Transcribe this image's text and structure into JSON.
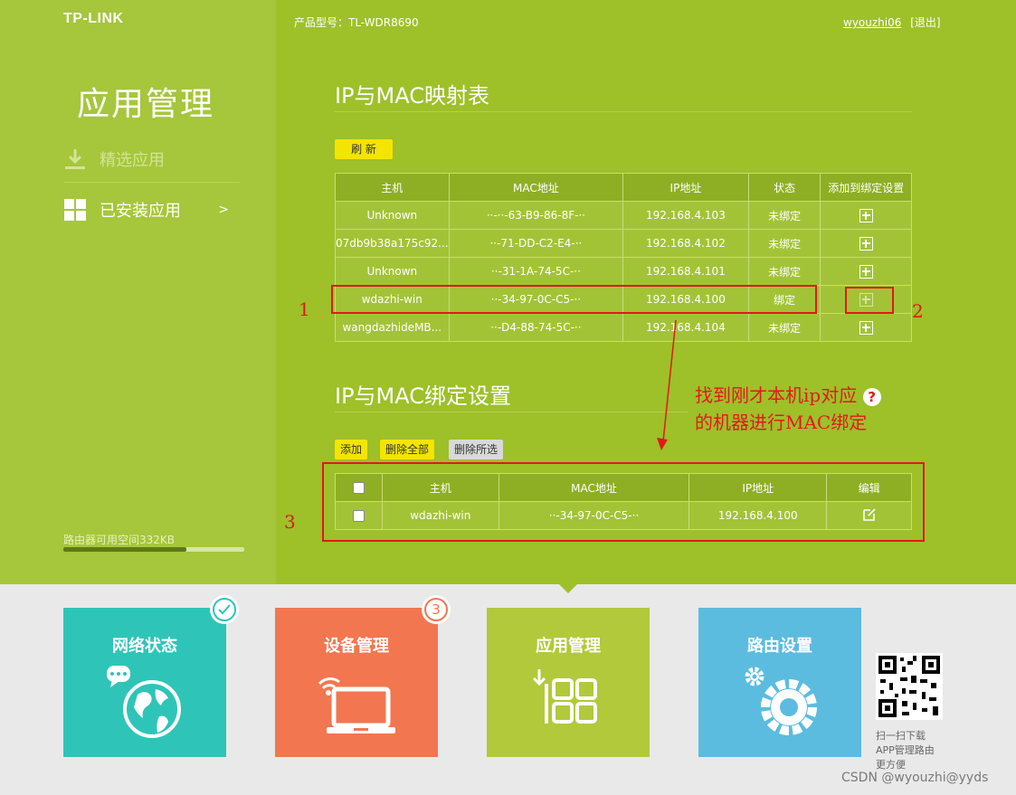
{
  "header": {
    "logo": "TP-LINK",
    "model": "产品型号：TL-WDR8690",
    "username": "wyouzhi06",
    "logout": "[退出]"
  },
  "sidebar": {
    "title": "应用管理",
    "items": [
      {
        "label": "精选应用",
        "icon": "download-icon"
      },
      {
        "label": "已安装应用",
        "icon": "grid-icon",
        "arrow": ">"
      }
    ],
    "storage_label": "路由器可用空间332KB",
    "storage_used_fraction": 0.68
  },
  "mapping": {
    "title": "IP与MAC映射表",
    "refresh_label": "刷 新",
    "columns": [
      "主机",
      "MAC地址",
      "IP地址",
      "状态",
      "添加到绑定设置"
    ],
    "rows": [
      {
        "host": "Unknown",
        "mac": "··-··-63-B9-86-8F-··",
        "ip": "192.168.4.103",
        "status": "未绑定"
      },
      {
        "host": "07db9b38a175c92...",
        "mac": "··-71-DD-C2-E4-··",
        "ip": "192.168.4.102",
        "status": "未绑定"
      },
      {
        "host": "Unknown",
        "mac": "··-31-1A-74-5C-··",
        "ip": "192.168.4.101",
        "status": "未绑定"
      },
      {
        "host": "wdazhi-win",
        "mac": "··-34-97-0C-C5-··",
        "ip": "192.168.4.100",
        "status": "绑定"
      },
      {
        "host": "wangdazhideMB...",
        "mac": "··-D4-88-74-5C-··",
        "ip": "192.168.4.104",
        "status": "未绑定"
      }
    ]
  },
  "binding": {
    "title": "IP与MAC绑定设置",
    "add_label": "添加",
    "delete_all_label": "删除全部",
    "delete_selected_label": "删除所选",
    "columns": [
      "主机",
      "MAC地址",
      "IP地址",
      "编辑"
    ],
    "rows": [
      {
        "host": "wdazhi-win",
        "mac": "··-34-97-0C-C5-··",
        "ip": "192.168.4.100"
      }
    ]
  },
  "annotations": {
    "num1": "1",
    "num2": "2",
    "num3": "3",
    "note_line1": "找到刚才本机ip对应",
    "note_line2": "的机器进行MAC绑定",
    "annotation_color": "#e01919"
  },
  "tiles": [
    {
      "label": "网络状态",
      "color": "#2ec5b8",
      "icon": "globe-icon",
      "badge": "check"
    },
    {
      "label": "设备管理",
      "color": "#f27650",
      "icon": "laptop-wifi-icon",
      "badge": "3"
    },
    {
      "label": "应用管理",
      "color": "#b2c93b",
      "icon": "apps-grid-icon"
    },
    {
      "label": "路由设置",
      "color": "#5bbce0",
      "icon": "gear-icon"
    }
  ],
  "qr": {
    "line1": "扫一扫下载",
    "line2": "APP管理路由",
    "line3": "更方便"
  },
  "watermark": "CSDN @wyouzhi@yyds"
}
